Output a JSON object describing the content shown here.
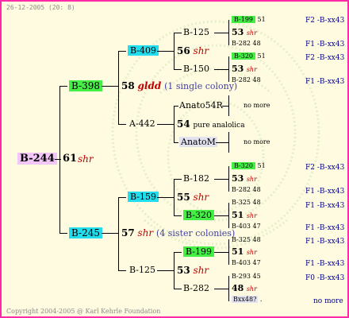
{
  "header": {
    "date": "26-12-2005 (20: 8)"
  },
  "footer": {
    "copyright": "Copyright 2004-2005 @ Karl Kehrle Foundation"
  },
  "root": {
    "id": "B-244",
    "year": "61",
    "race": "shr"
  },
  "gen1": [
    {
      "id": "B-398"
    },
    {
      "id": "B-245"
    }
  ],
  "gen2": {
    "b398": {
      "year": "58",
      "race": "gldd",
      "note": "(1 single colony)"
    },
    "b245": {
      "year": "57",
      "race": "shr",
      "note": "(4 sister colonies)"
    }
  },
  "gen3": {
    "b409": "B-409",
    "a442": "A-442",
    "b159": "B-159",
    "b125": "B-125"
  },
  "gen4": {
    "n56": {
      "year": "56",
      "race": "shr"
    },
    "n54": {
      "year": "54",
      "race": "pure analolica"
    },
    "n55": {
      "year": "55",
      "race": "shr"
    },
    "n53": {
      "year": "53",
      "race": "shr"
    }
  },
  "gen5": {
    "b125": "B-125",
    "b150": "B-150",
    "anato54r": "Anato54R",
    "anatom": "AnatoM",
    "b182": "B-182",
    "b320": "B-320",
    "b199": "B-199",
    "b282": "B-282"
  },
  "nomore": "no more",
  "gen6": [
    {
      "id": "B-199",
      "num": "51",
      "year": "53",
      "race": "shr",
      "sub": "B-282",
      "subnum": "48",
      "code1": "F2 -B-xx43",
      "code2": "F1 -B-xx43"
    },
    {
      "id": "B-320",
      "num": "51",
      "year": "53",
      "race": "shr",
      "sub": "B-282",
      "subnum": "48",
      "code1": "F2 -B-xx43",
      "code2": "F1 -B-xx43"
    },
    {
      "id": "B-320",
      "num": "51",
      "year": "53",
      "race": "shr",
      "sub": "B-282",
      "subnum": "48",
      "code1": "F2 -B-xx43",
      "code2": "F1 -B-xx43"
    },
    {
      "id": "B-325",
      "num": "48",
      "year": "51",
      "race": "shr",
      "sub": "B-403",
      "subnum": "47",
      "code1": "F1 -B-xx43",
      "code2": "F1 -B-xx43"
    },
    {
      "id": "B-325",
      "num": "48",
      "year": "51",
      "race": "shr",
      "sub": "B-403",
      "subnum": "47",
      "code1": "F1 -B-xx43",
      "code2": "F1 -B-xx43"
    },
    {
      "id": "B-293",
      "num": "45",
      "year": "48",
      "race": "shr",
      "sub": "Bxx48?",
      "subnum": ".",
      "code1": "F0 -B-xx43",
      "code2": "no more"
    }
  ]
}
